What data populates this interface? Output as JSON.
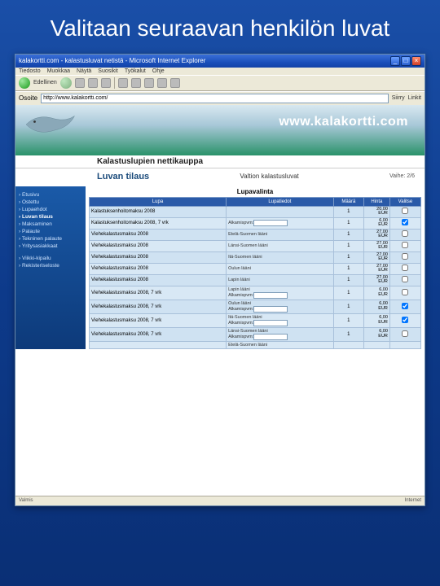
{
  "slide": {
    "title": "Valitaan seuraavan henkilön luvat"
  },
  "window": {
    "title": "kalakortti.com - kalastusluvat netistä - Microsoft Internet Explorer"
  },
  "menubar": [
    "Tiedosto",
    "Muokkaa",
    "Näytä",
    "Suosikit",
    "Työkalut",
    "Ohje"
  ],
  "toolbar": {
    "back": "Edellinen",
    "forward": ""
  },
  "address": {
    "label": "Osoite",
    "value": "http://www.kalakortti.com/",
    "go": "Siirry",
    "links": "Linkit"
  },
  "site": {
    "name": "www.kalakortti.com",
    "subheader": "Kalastuslupien nettikauppa",
    "order_title": "Luvan tilaus",
    "section_title": "Valtion kalastusluvat",
    "step": "Vaihe: 2/6",
    "table_title": "Lupavalinta"
  },
  "sidebar": [
    {
      "label": "Etusivu"
    },
    {
      "label": "Ostettu"
    },
    {
      "label": "Lupaehdot"
    },
    {
      "label": "Luvan tilaus",
      "active": true
    },
    {
      "label": "Maksaminen"
    },
    {
      "label": "Palaute"
    },
    {
      "label": "Tekninen palaute"
    },
    {
      "label": "Yritysasiakkaat"
    },
    {
      "label": "Viikki-kipailu",
      "gap": true
    },
    {
      "label": "Rekisteriseloste"
    }
  ],
  "table": {
    "headers": [
      "Lupa",
      "Lupatiedot",
      "Määrä",
      "Hinta",
      "Valitse"
    ],
    "date_label": "Alkamispvm:",
    "rows": [
      {
        "lupa": "Kalastuksenhoitomaksu 2008",
        "tiedot": "",
        "maara": "1",
        "hinta": "20,00 EUR",
        "checked": false,
        "has_date": false
      },
      {
        "lupa": "Kalastuksenhoitomaksu 2008, 7 vrk",
        "tiedot": "",
        "maara": "1",
        "hinta": "6,00 EUR",
        "checked": true,
        "has_date": true
      },
      {
        "lupa": "Viehekalastusmaksu 2008",
        "tiedot": "Etelä-Suomen lääni",
        "maara": "1",
        "hinta": "27,00 EUR",
        "checked": false,
        "has_date": false
      },
      {
        "lupa": "Viehekalastusmaksu 2008",
        "tiedot": "Länsi-Suomen lääni",
        "maara": "1",
        "hinta": "27,00 EUR",
        "checked": false,
        "has_date": false
      },
      {
        "lupa": "Viehekalastusmaksu 2008",
        "tiedot": "Itä-Suomen lääni",
        "maara": "1",
        "hinta": "27,00 EUR",
        "checked": false,
        "has_date": false
      },
      {
        "lupa": "Viehekalastusmaksu 2008",
        "tiedot": "Oulun lääni",
        "maara": "1",
        "hinta": "27,00 EUR",
        "checked": false,
        "has_date": false
      },
      {
        "lupa": "Viehekalastusmaksu 2008",
        "tiedot": "Lapin lääni",
        "maara": "1",
        "hinta": "27,00 EUR",
        "checked": false,
        "has_date": false
      },
      {
        "lupa": "Viehekalastusmaksu 2008, 7 vrk",
        "tiedot": "Lapin lääni",
        "maara": "1",
        "hinta": "6,00 EUR",
        "checked": false,
        "has_date": true
      },
      {
        "lupa": "Viehekalastusmaksu 2008, 7 vrk",
        "tiedot": "Oulun lääni",
        "maara": "1",
        "hinta": "6,00 EUR",
        "checked": true,
        "has_date": true
      },
      {
        "lupa": "Viehekalastusmaksu 2008, 7 vrk",
        "tiedot": "Itä-Suomen lääni",
        "maara": "1",
        "hinta": "6,00 EUR",
        "checked": true,
        "has_date": true
      },
      {
        "lupa": "Viehekalastusmaksu 2008, 7 vrk",
        "tiedot": "Länsi-Suomen lääni",
        "maara": "1",
        "hinta": "6,00 EUR",
        "checked": false,
        "has_date": true
      },
      {
        "lupa": "",
        "tiedot": "Etelä-Suomen lääni",
        "maara": "",
        "hinta": "",
        "checked": false,
        "has_date": false
      }
    ]
  },
  "status": {
    "left": "Valmis",
    "right": "Internet"
  }
}
